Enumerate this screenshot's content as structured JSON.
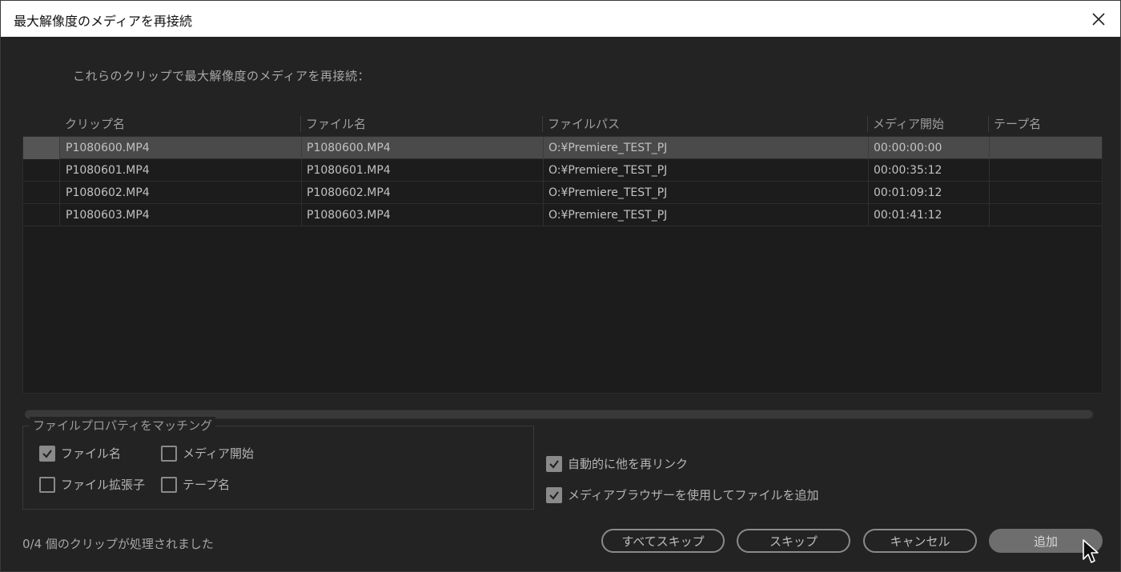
{
  "window": {
    "title": "最大解像度のメディアを再接続",
    "close_icon": "close-icon"
  },
  "prompt": "これらのクリップで最大解像度のメディアを再接続：",
  "table": {
    "columns": [
      "クリップ名",
      "ファイル名",
      "ファイルパス",
      "メディア開始",
      "テープ名"
    ],
    "rows": [
      {
        "clip": "P1080600.MP4",
        "file": "P1080600.MP4",
        "path": "O:¥Premiere_TEST_PJ",
        "start": "00:00:00:00",
        "tape": "",
        "selected": true
      },
      {
        "clip": "P1080601.MP4",
        "file": "P1080601.MP4",
        "path": "O:¥Premiere_TEST_PJ",
        "start": "00:00:35:12",
        "tape": "",
        "selected": false
      },
      {
        "clip": "P1080602.MP4",
        "file": "P1080602.MP4",
        "path": "O:¥Premiere_TEST_PJ",
        "start": "00:01:09:12",
        "tape": "",
        "selected": false
      },
      {
        "clip": "P1080603.MP4",
        "file": "P1080603.MP4",
        "path": "O:¥Premiere_TEST_PJ",
        "start": "00:01:41:12",
        "tape": "",
        "selected": false
      }
    ]
  },
  "matching": {
    "legend": "ファイルプロパティをマッチング",
    "file_name": {
      "label": "ファイル名",
      "checked": true
    },
    "media_start": {
      "label": "メディア開始",
      "checked": false
    },
    "file_ext": {
      "label": "ファイル拡張子",
      "checked": false
    },
    "tape_name": {
      "label": "テープ名",
      "checked": false
    }
  },
  "options": {
    "auto_relink": {
      "label": "自動的に他を再リンク",
      "checked": true
    },
    "use_media_browser": {
      "label": "メディアブラウザーを使用してファイルを追加",
      "checked": true
    }
  },
  "status": "0/4 個のクリップが処理されました",
  "buttons": {
    "skip_all": "すべてスキップ",
    "skip": "スキップ",
    "cancel": "キャンセル",
    "add": "追加"
  },
  "colors": {
    "background": "#232323",
    "selected_row": "#4a4a4a",
    "checkbox_fill": "#8a8a8a"
  }
}
